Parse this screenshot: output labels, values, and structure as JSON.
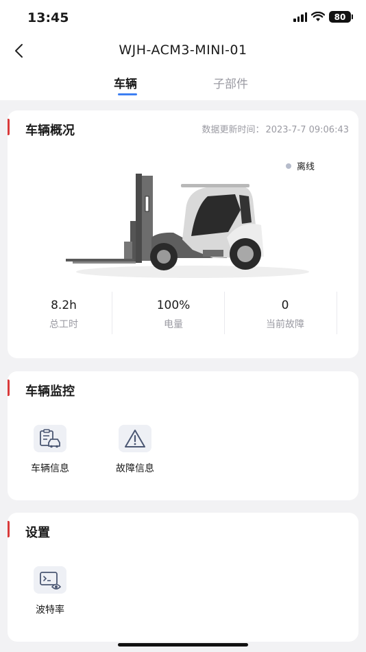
{
  "status_bar": {
    "time": "13:45",
    "battery": "80"
  },
  "header": {
    "title": "WJH-ACM3-MINI-01"
  },
  "tabs": [
    {
      "label": "车辆",
      "active": true
    },
    {
      "label": "子部件",
      "active": false
    }
  ],
  "overview": {
    "title": "车辆概况",
    "update_label": "数据更新时间：",
    "update_time": "2023-7-7 09:06:43",
    "status": "离线",
    "stats": [
      {
        "value": "8.2h",
        "label": "总工时"
      },
      {
        "value": "100%",
        "label": "电量"
      },
      {
        "value": "0",
        "label": "当前故障"
      }
    ]
  },
  "monitor": {
    "title": "车辆监控",
    "items": [
      {
        "label": "车辆信息",
        "icon": "vehicle-info-icon"
      },
      {
        "label": "故障信息",
        "icon": "warning-icon"
      }
    ]
  },
  "settings": {
    "title": "设置",
    "items": [
      {
        "label": "波特率",
        "icon": "baud-rate-icon"
      }
    ]
  },
  "colors": {
    "accent": "#3d7ff2",
    "section_bar": "#d93a3a",
    "muted": "#9a9aa2",
    "offline_dot": "#b6bccb"
  }
}
